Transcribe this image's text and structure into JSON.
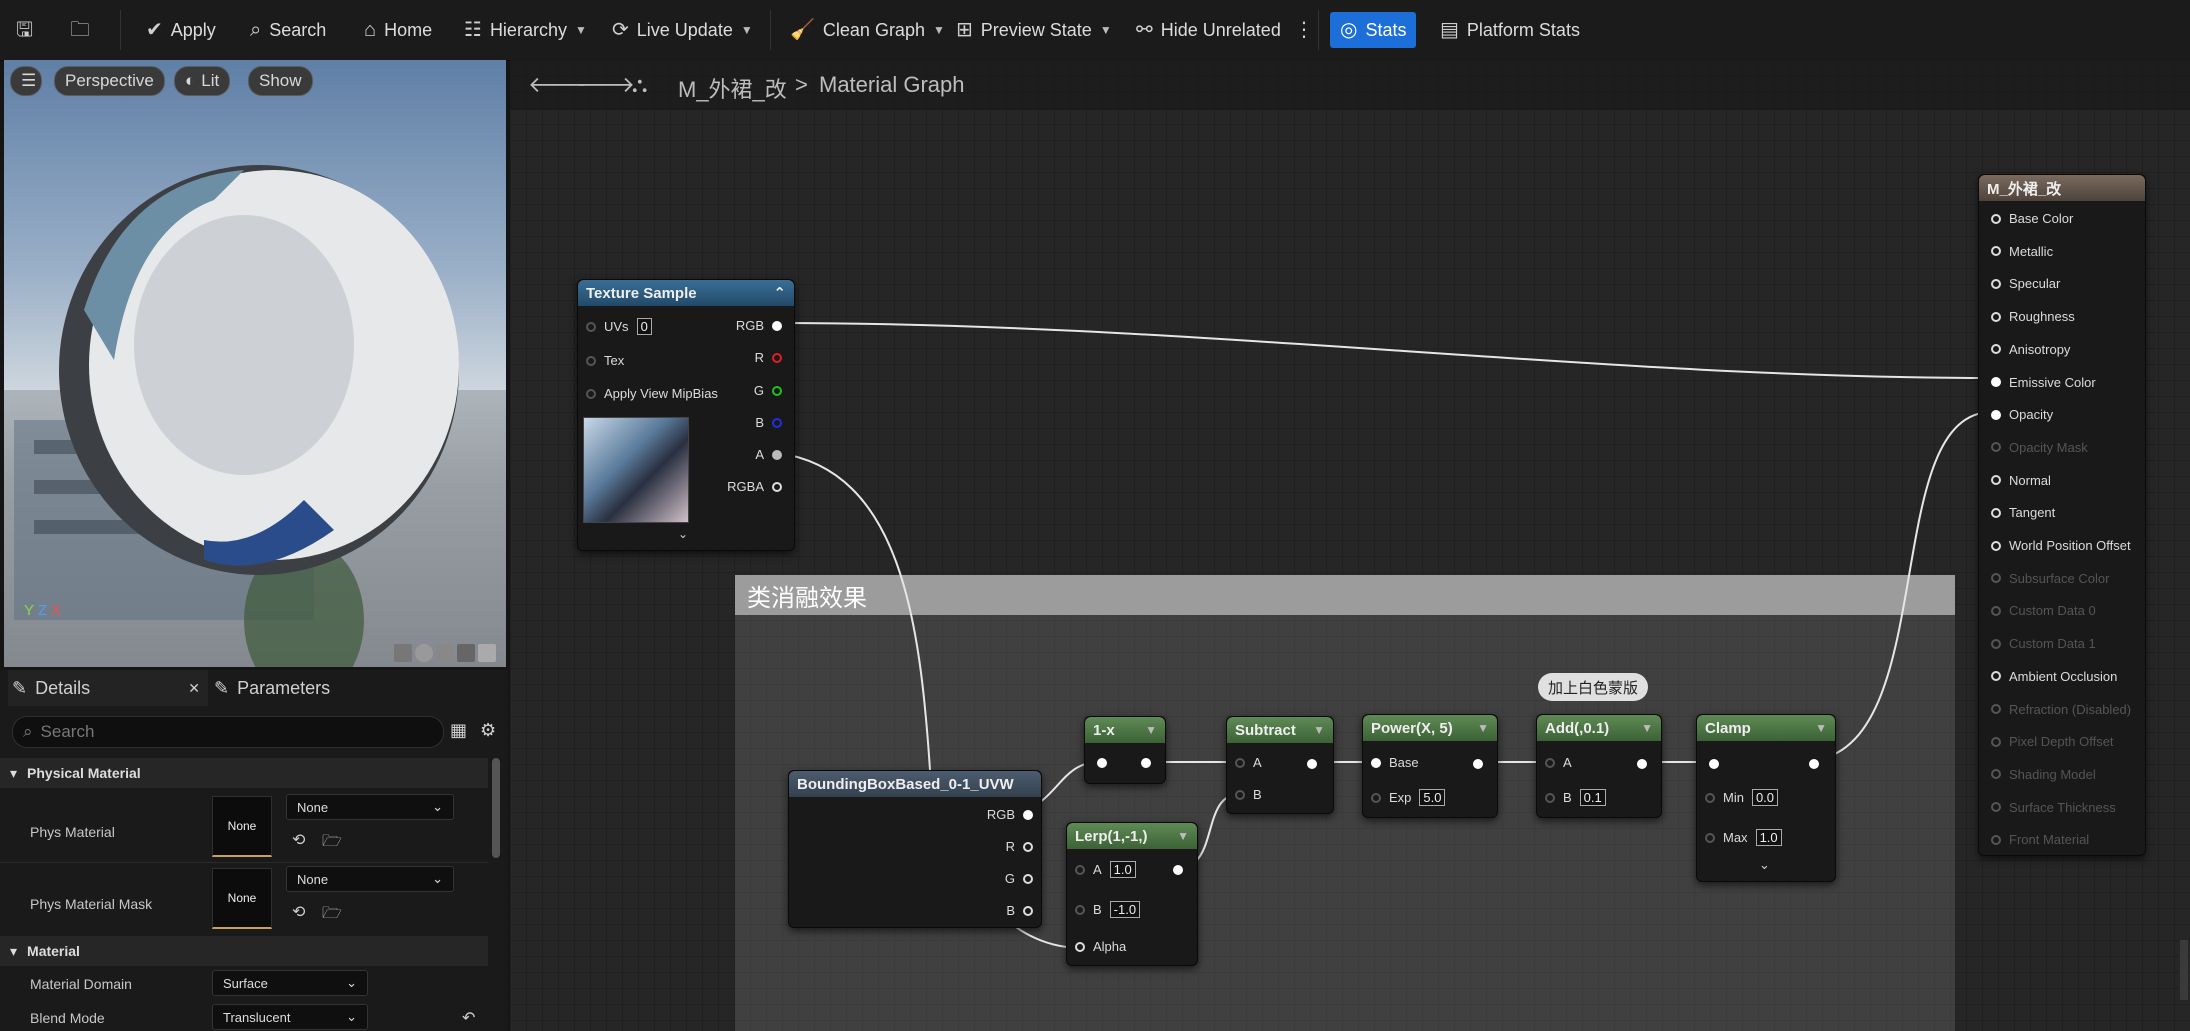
{
  "toolbar": {
    "apply": "Apply",
    "search": "Search",
    "home": "Home",
    "hierarchy": "Hierarchy",
    "live_update": "Live Update",
    "clean_graph": "Clean Graph",
    "preview_state": "Preview State",
    "hide_unrelated": "Hide Unrelated",
    "stats": "Stats",
    "platform_stats": "Platform Stats",
    "accent": "#1c6fd9"
  },
  "viewport": {
    "perspective": "Perspective",
    "lit": "Lit",
    "show": "Show",
    "axes": {
      "y": "Y",
      "z": "Z",
      "x": "X"
    }
  },
  "details": {
    "tab_details": "Details",
    "tab_parameters": "Parameters",
    "search_placeholder": "Search",
    "sections": {
      "physical": "Physical Material",
      "material": "Material"
    },
    "rows": {
      "phys_material": {
        "label": "Phys Material",
        "thumb": "None",
        "value": "None"
      },
      "phys_material_mask": {
        "label": "Phys Material Mask",
        "thumb": "None",
        "value": "None"
      },
      "material_domain": {
        "label": "Material Domain",
        "value": "Surface"
      },
      "blend_mode": {
        "label": "Blend Mode",
        "value": "Translucent"
      }
    }
  },
  "breadcrumb": {
    "asset": "M_外裙_改",
    "separator": ">",
    "graph": "Material Graph"
  },
  "nodes": {
    "texture_sample": {
      "title": "Texture Sample",
      "inputs": {
        "uvs": "UVs",
        "uvs_val": "0",
        "tex": "Tex",
        "mip": "Apply View MipBias"
      },
      "outputs": {
        "rgb": "RGB",
        "r": "R",
        "g": "G",
        "b": "B",
        "a": "A",
        "rgba": "RGBA"
      }
    },
    "comment": {
      "title": "类消融效果"
    },
    "bbox": {
      "title": "BoundingBoxBased_0-1_UVW",
      "outputs": {
        "rgb": "RGB",
        "r": "R",
        "g": "G",
        "b": "B"
      }
    },
    "one_minus": {
      "title": "1-x"
    },
    "lerp": {
      "title": "Lerp(1,-1,)",
      "a": "A",
      "a_val": "1.0",
      "b": "B",
      "b_val": "-1.0",
      "alpha": "Alpha"
    },
    "subtract": {
      "title": "Subtract",
      "a": "A",
      "b": "B"
    },
    "power": {
      "title": "Power(X, 5)",
      "base": "Base",
      "exp": "Exp",
      "exp_val": "5.0"
    },
    "add": {
      "title": "Add(,0.1)",
      "a": "A",
      "b": "B",
      "b_val": "0.1",
      "bubble": "加上白色蒙版"
    },
    "clamp": {
      "title": "Clamp",
      "min": "Min",
      "min_val": "0.0",
      "max": "Max",
      "max_val": "1.0"
    },
    "result": {
      "title": "M_外裙_改",
      "pins": [
        {
          "label": "Base Color",
          "enabled": true
        },
        {
          "label": "Metallic",
          "enabled": true
        },
        {
          "label": "Specular",
          "enabled": true
        },
        {
          "label": "Roughness",
          "enabled": true
        },
        {
          "label": "Anisotropy",
          "enabled": true
        },
        {
          "label": "Emissive Color",
          "enabled": true
        },
        {
          "label": "Opacity",
          "enabled": true
        },
        {
          "label": "Opacity Mask",
          "enabled": false
        },
        {
          "label": "Normal",
          "enabled": true
        },
        {
          "label": "Tangent",
          "enabled": true
        },
        {
          "label": "World Position Offset",
          "enabled": true
        },
        {
          "label": "Subsurface Color",
          "enabled": false
        },
        {
          "label": "Custom Data 0",
          "enabled": false
        },
        {
          "label": "Custom Data 1",
          "enabled": false
        },
        {
          "label": "Ambient Occlusion",
          "enabled": true
        },
        {
          "label": "Refraction (Disabled)",
          "enabled": false
        },
        {
          "label": "Pixel Depth Offset",
          "enabled": false
        },
        {
          "label": "Shading Model",
          "enabled": false
        },
        {
          "label": "Surface Thickness",
          "enabled": false
        },
        {
          "label": "Front Material",
          "enabled": false
        }
      ]
    }
  }
}
